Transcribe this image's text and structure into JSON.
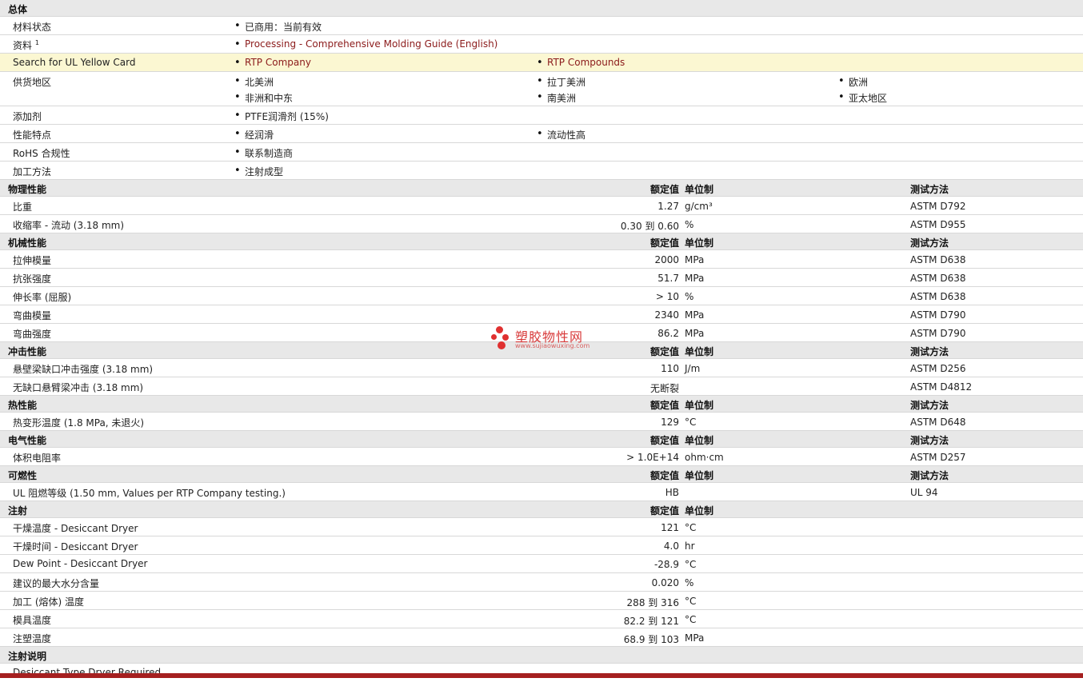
{
  "general": {
    "title": "总体",
    "material_status": {
      "label": "材料状态",
      "value": "已商用：当前有效"
    },
    "literature": {
      "label": "资料",
      "sup": "1",
      "value": "Processing - Comprehensive Molding Guide (English)"
    },
    "ul_card": {
      "label": "Search for UL Yellow Card",
      "values": [
        "RTP Company",
        "RTP Compounds"
      ]
    },
    "regions": {
      "label": "供货地区",
      "values": [
        "北美洲",
        "拉丁美洲",
        "欧洲",
        "非洲和中东",
        "南美洲",
        "亚太地区"
      ]
    },
    "additive": {
      "label": "添加剂",
      "value": "PTFE润滑剂 (15%)"
    },
    "features": {
      "label": "性能特点",
      "values": [
        "经润滑",
        "流动性高"
      ]
    },
    "rohs": {
      "label": "RoHS 合规性",
      "value": "联系制造商"
    },
    "processing": {
      "label": "加工方法",
      "value": "注射成型"
    }
  },
  "col_headers": {
    "rated": "额定值",
    "unit": "单位制",
    "method": "测试方法"
  },
  "sections": [
    {
      "title": "物理性能",
      "has_method": true,
      "rows": [
        {
          "label": "比重",
          "value": "1.27",
          "unit": "g/cm³",
          "method": "ASTM D792"
        },
        {
          "label": "收缩率  - 流动 (3.18 mm)",
          "value": "0.30 到  0.60",
          "unit": "%",
          "method": "ASTM D955"
        }
      ]
    },
    {
      "title": "机械性能",
      "has_method": true,
      "rows": [
        {
          "label": "拉伸模量",
          "value": "2000",
          "unit": "MPa",
          "method": "ASTM D638"
        },
        {
          "label": "抗张强度",
          "value": "51.7",
          "unit": "MPa",
          "method": "ASTM D638"
        },
        {
          "label": "伸长率 (屈服)",
          "value": "> 10",
          "unit": "%",
          "method": "ASTM D638"
        },
        {
          "label": "弯曲模量",
          "value": "2340",
          "unit": "MPa",
          "method": "ASTM D790"
        },
        {
          "label": "弯曲强度",
          "value": "86.2",
          "unit": "MPa",
          "method": "ASTM D790"
        }
      ]
    },
    {
      "title": "冲击性能",
      "has_method": true,
      "rows": [
        {
          "label": "悬壁梁缺口冲击强度 (3.18 mm)",
          "value": "110",
          "unit": "J/m",
          "method": "ASTM D256"
        },
        {
          "label": "无缺口悬臂梁冲击 (3.18 mm)",
          "value": "无断裂",
          "unit": "",
          "method": "ASTM D4812"
        }
      ]
    },
    {
      "title": "热性能",
      "has_method": true,
      "rows": [
        {
          "label": "热变形温度 (1.8 MPa, 未退火)",
          "value": "129",
          "unit": "°C",
          "method": "ASTM D648"
        }
      ]
    },
    {
      "title": "电气性能",
      "has_method": true,
      "rows": [
        {
          "label": "体积电阻率",
          "value": "> 1.0E+14",
          "unit": "ohm·cm",
          "method": "ASTM D257"
        }
      ]
    },
    {
      "title": "可燃性",
      "has_method": true,
      "rows": [
        {
          "label": "UL 阻燃等级 (1.50 mm, Values per RTP Company testing.)",
          "value": "HB",
          "unit": "",
          "method": "UL 94"
        }
      ]
    },
    {
      "title": "注射",
      "has_method": false,
      "rows": [
        {
          "label": "干燥温度  - Desiccant Dryer",
          "value": "121",
          "unit": "°C",
          "method": ""
        },
        {
          "label": "干燥时间  - Desiccant Dryer",
          "value": "4.0",
          "unit": "hr",
          "method": ""
        },
        {
          "label": "Dew Point - Desiccant Dryer",
          "value": "-28.9",
          "unit": "°C",
          "method": ""
        },
        {
          "label": "建议的最大水分含量",
          "value": "0.020",
          "unit": "%",
          "method": ""
        },
        {
          "label": "加工 (熔体) 温度",
          "value": "288 到  316",
          "unit": "°C",
          "method": ""
        },
        {
          "label": "模具温度",
          "value": "82.2 到  121",
          "unit": "°C",
          "method": ""
        },
        {
          "label": "注塑温度",
          "value": "68.9 到  103",
          "unit": "MPa",
          "method": ""
        }
      ]
    }
  ],
  "injection_notes": {
    "title": "注射说明",
    "text": "Desiccant Type Dryer Required."
  },
  "watermark": {
    "name": "塑胶物性网",
    "url": "www.sujiaowuxing.com"
  }
}
